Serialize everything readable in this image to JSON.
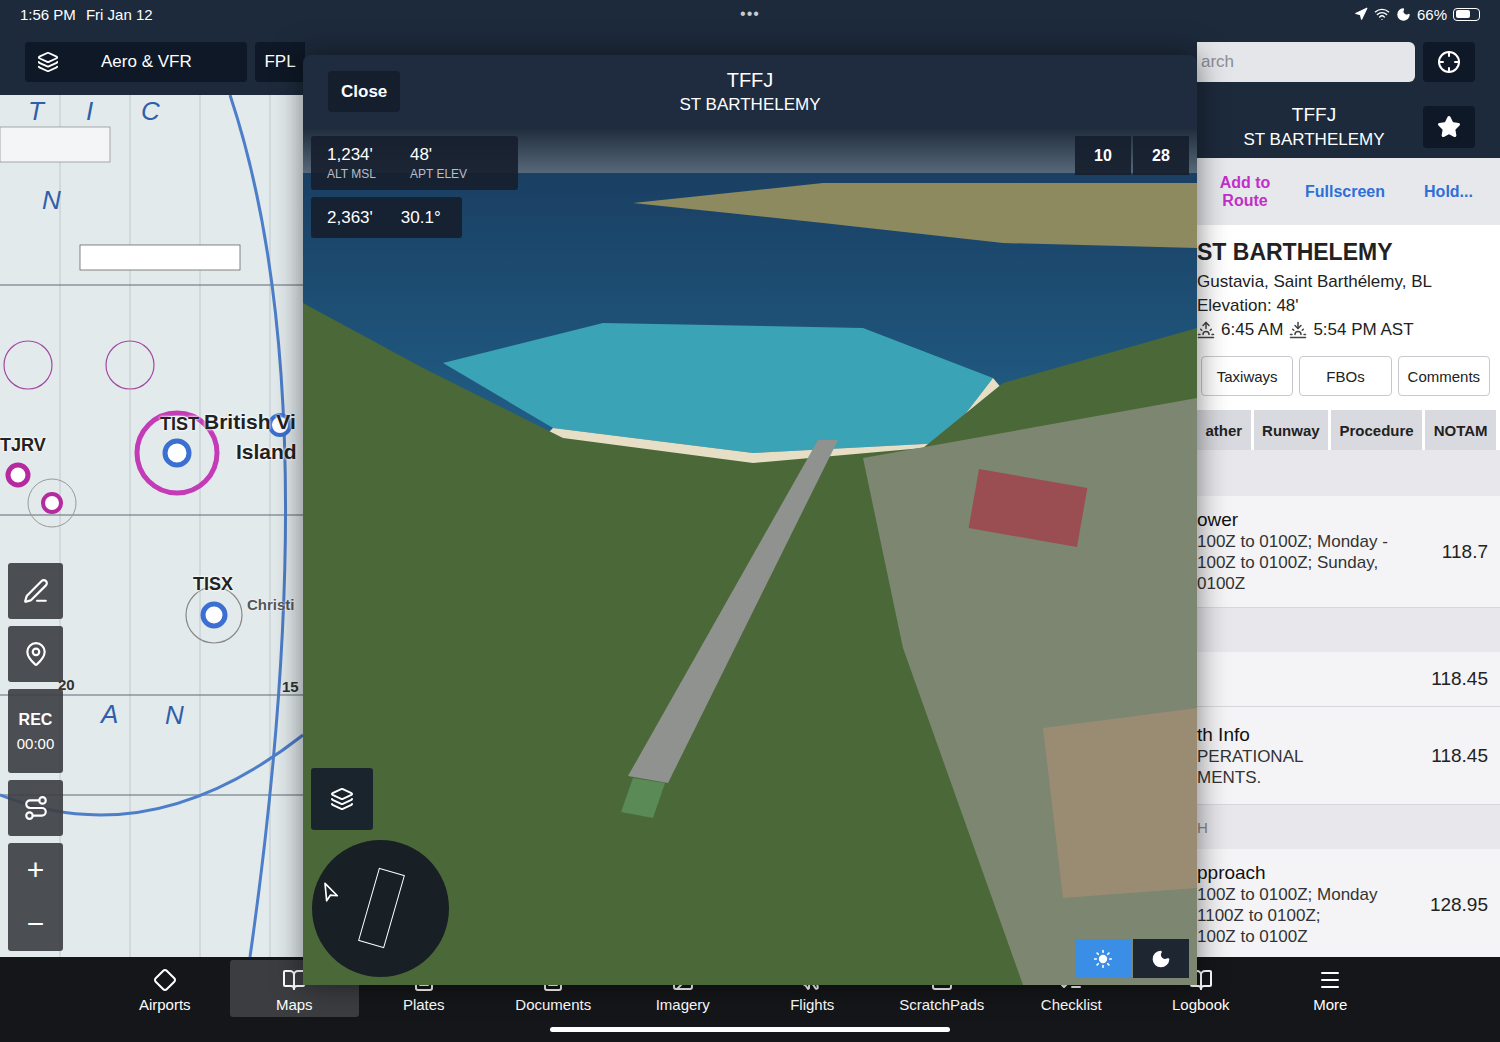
{
  "status_bar": {
    "time": "1:56 PM",
    "date": "Fri Jan 12",
    "handle": "•••",
    "battery": "66%",
    "battery_level": 0.66
  },
  "toolbar": {
    "layers": "Aero & VFR",
    "flight_plan": "FPL",
    "search": {
      "placeholder": "arch"
    }
  },
  "map": {
    "labels": [
      {
        "text": "T",
        "kind": "region"
      },
      {
        "text": "I",
        "kind": "region"
      },
      {
        "text": "C",
        "kind": "region"
      },
      {
        "text": "N",
        "kind": "region"
      },
      {
        "text": "TIST",
        "kind": "airport"
      },
      {
        "text": "British Vi",
        "kind": "place"
      },
      {
        "text": "Island",
        "kind": "place"
      },
      {
        "text": "TJRV",
        "kind": "airport"
      },
      {
        "text": "TISX",
        "kind": "airport"
      },
      {
        "text": "Christi",
        "kind": "small"
      },
      {
        "text": "20",
        "kind": "number"
      },
      {
        "text": "15",
        "kind": "number"
      },
      {
        "text": "A",
        "kind": "region"
      },
      {
        "text": "N",
        "kind": "region"
      }
    ]
  },
  "map_tools": {
    "record": "REC",
    "timer": "00:00",
    "zoom_in": "+",
    "zoom_out": "−"
  },
  "modal": {
    "close": "Close",
    "ident": "TFFJ",
    "name": "ST BARTHELEMY",
    "readouts": [
      {
        "value": "1,234'",
        "label": "ALT MSL"
      },
      {
        "value": "48'",
        "label": "APT ELEV"
      }
    ],
    "geometry": [
      "2,363'",
      "30.1°"
    ],
    "runways": [
      {
        "label": "10",
        "selected": false
      },
      {
        "label": "28",
        "selected": false
      }
    ],
    "lighting": [
      {
        "kind": "day",
        "selected": true
      },
      {
        "kind": "night",
        "selected": false
      }
    ]
  },
  "airport_panel": {
    "ident": "TFFJ",
    "name": "ST BARTHELEMY",
    "favorite": false,
    "actions": [
      {
        "label": "Add to Route",
        "color": "#c12fc9"
      },
      {
        "label": "Fullscreen",
        "color": "#2f6fd6"
      },
      {
        "label": "Hold...",
        "color": "#2f6fd6"
      }
    ],
    "title": "ST BARTHELEMY",
    "location": "Gustavia, Saint Barthélemy, BL",
    "elevation": "Elevation: 48'",
    "sunrise": "6:45 AM",
    "sunset": "5:54 PM AST",
    "buttons": [
      "Taxiways",
      "FBOs",
      "Comments"
    ],
    "tabs": [
      {
        "label": "ather",
        "selected": false
      },
      {
        "label": "Runway",
        "selected": false
      },
      {
        "label": "Procedure",
        "selected": false
      },
      {
        "label": "NOTAM",
        "selected": false
      }
    ],
    "frequencies": [
      {
        "kind": "header",
        "label": ""
      },
      {
        "kind": "row",
        "title": "ower",
        "lines": [
          "100Z to 0100Z; Monday -",
          "100Z to 0100Z; Sunday,",
          "0100Z"
        ],
        "freq": "118.7"
      },
      {
        "kind": "header",
        "label": ""
      },
      {
        "kind": "row",
        "title": "",
        "lines": [],
        "freq": "118.45"
      },
      {
        "kind": "row",
        "title": "th Info",
        "lines": [
          "PERATIONAL",
          "MENTS."
        ],
        "freq": "118.45"
      },
      {
        "kind": "header",
        "label": "H"
      },
      {
        "kind": "row",
        "title": "pproach",
        "lines": [
          "100Z to 0100Z; Monday",
          "1100Z to 0100Z;",
          "100Z to 0100Z"
        ],
        "freq": "128.95"
      }
    ]
  },
  "tab_bar": {
    "items": [
      {
        "label": "Airports",
        "selected": false
      },
      {
        "label": "Maps",
        "selected": true
      },
      {
        "label": "Plates",
        "selected": false
      },
      {
        "label": "Documents",
        "selected": false
      },
      {
        "label": "Imagery",
        "selected": false
      },
      {
        "label": "Flights",
        "selected": false
      },
      {
        "label": "ScratchPads",
        "selected": false
      },
      {
        "label": "Checklist",
        "selected": false
      },
      {
        "label": "Logbook",
        "selected": false
      },
      {
        "label": "More",
        "selected": false
      }
    ]
  }
}
